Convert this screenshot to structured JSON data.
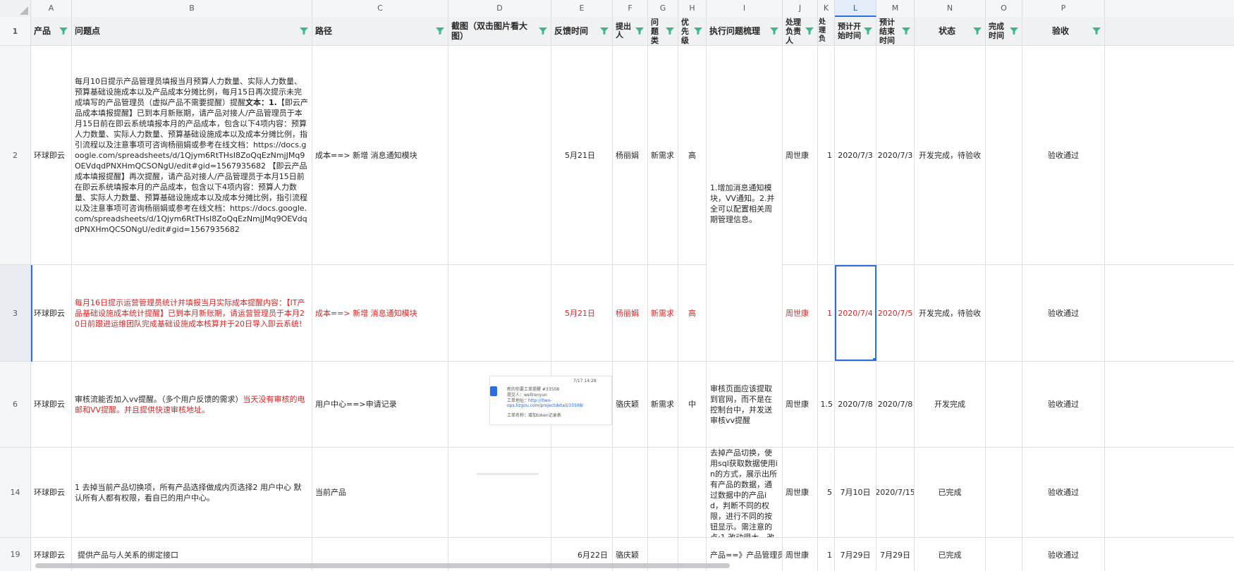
{
  "column_letters": [
    "A",
    "B",
    "C",
    "D",
    "E",
    "F",
    "G",
    "H",
    "I",
    "J",
    "K",
    "L",
    "M",
    "N",
    "O",
    "P"
  ],
  "selected_column": "L",
  "headers": {
    "A": "产品",
    "B": "问题点",
    "C": "路径",
    "D": "截图（双击图片看大图）",
    "E": "反馈时间",
    "F": "提出人",
    "G": "问题类",
    "H": "优先级",
    "I": "执行问题梳理",
    "J": "处理负责人",
    "K": "处理负",
    "L": "预计开始时间",
    "M": "预计结束时间",
    "N": "状态",
    "O": "完成时间",
    "P": "验收"
  },
  "rows": [
    {
      "num": "2",
      "product": "环球即云",
      "issue_plain": "每月10日提示产品管理员填报当月预算人力数量、实际人力数量、预算基础设施成本以及产品成本分摊比例，每月15日再次提示未完成填写的产品管理员（虚拟产品不需要提醒）提醒",
      "issue_bold": "文本：1.",
      "issue_rest": "【即云产品成本填报提醒】已到本月新账期，请产品对接人/产品管理员于本月15日前在即云系统填报本月的产品成本，包含以下4项内容：预算人力数量、实际人力数量、预算基础设施成本以及成本分摊比例，指引流程以及注意事项可咨询杨丽娟或参考在线文档：https://docs.google.com/spreadsheets/d/1Qjym6RtTHsI8ZoQqEzNmjJMq9OEVdqdPNXHmQCSONgU/edit#gid=1567935682 【即云产品成本填报提醒】再次提醒，请产品对接人/产品管理员于本月15日前在即云系统填报本月的产品成本，包含以下4项内容：预算人力数量、实际人力数量、预算基础设施成本以及成本分摊比例，指引流程以及注意事项可咨询杨丽娟或参考在线文档：https://docs.google.com/spreadsheets/d/1Qjym6RtTHsI8ZoQqEzNmjJMq9OEVdqdPNXHmQCSONgU/edit#gid=1567935682",
      "path": "成本==> 新增 消息通知模块",
      "feedback_date": "5月21日",
      "proposer": "杨丽娟",
      "type": "新需求",
      "priority": "高",
      "owner": "周世康",
      "load": "1",
      "start": "2020/7/3",
      "end": "2020/7/3",
      "status": "开发完成，待验收",
      "done": "",
      "accept": "验收通过"
    },
    {
      "num": "3",
      "product": "环球即云",
      "issue_plain": "每月16日提示运营管理员统计并填报当月实际成本提醒内容：【IT产品基础设施成本统计提醒】已到本月新账期，请运营管理员于本月20日前跟进运维团队完成基础设施成本核算并于20日导入即云系统!",
      "path": "成本==> 新增 消息通知模块",
      "feedback_date": "5月21日",
      "proposer": "杨丽娟",
      "type": "新需求",
      "priority": "高",
      "owner": "周世康",
      "load": "1",
      "start": "2020/7/4",
      "end": "2020/7/5",
      "status": "开发完成，待验收",
      "done": "",
      "accept": "验收通过"
    },
    {
      "num": "6",
      "product": "环球即云",
      "issue_plain": "审核流能否加入vv提醒。（多个用户反馈的需求）",
      "issue_red": "当天没有审核的电邮和VV提醒。并且提供快速审核地址。",
      "path": "用户中心==>申请记录",
      "feedback_date": "5月30日",
      "proposer": "骆庆颖",
      "type": "新需求",
      "priority": "中",
      "exec": "审核页面应该提取到官网，而不是在控制台中，并发送审核vv提醒",
      "owner": "周世康",
      "load": "1.5",
      "start": "2020/7/8",
      "end": "2020/7/8",
      "status": "开发完成",
      "done": "",
      "accept": "验收通过"
    },
    {
      "num": "14",
      "product": "环球即云",
      "issue_plain": "1 去掉当前产品切换项，所有产品选择做成内页选择2 用户中心 默认所有人都有权限，看自已的用户中心。",
      "path": "当前产品",
      "feedback_date": "",
      "proposer": "",
      "type": "",
      "priority": "",
      "exec": "去掉产品切换，使用sql获取数据使用in的方式，展示出所有产品的数据，通过数据中的产品id，判断不同的权限，进行不同的按钮显示。需注意的点:1.改动很大，改",
      "owner": "周世康",
      "load": "5",
      "start": "7月10日",
      "end": "2020/7/15",
      "status": "已完成",
      "done": "",
      "accept": "验收通过"
    },
    {
      "num": "19",
      "product": "环球即云",
      "issue_plain": "提供产品与人关系的绑定接口",
      "path": "",
      "feedback_date": "6月22日",
      "proposer": "骆庆颖",
      "type": "",
      "priority": "",
      "exec": "产品==》产品管理员",
      "owner": "周世康",
      "load": "1",
      "start": "7月29日",
      "end": "7月29日",
      "status": "已完成",
      "done": "",
      "accept": "验收通过"
    }
  ],
  "merged_exec_rows_2_3": "1.增加消息通知模块，VV通知。2.并全可以配置相关周期管理信息。",
  "screenshot_thumb": {
    "time": "7/17 14:28",
    "line1": "新的你要工单提醒 #33508",
    "line2": "提交人：wellrenyun",
    "line3": "工单地址：",
    "link": "http://itwo-ops.hzgou.com/projectdetail/33508/",
    "line4": "工单名称：",
    "line4_val": "增加token记录表"
  },
  "colors": {
    "accent": "#2b6de5",
    "red_text": "#e02424",
    "filter_icon": "#3fb58a"
  }
}
